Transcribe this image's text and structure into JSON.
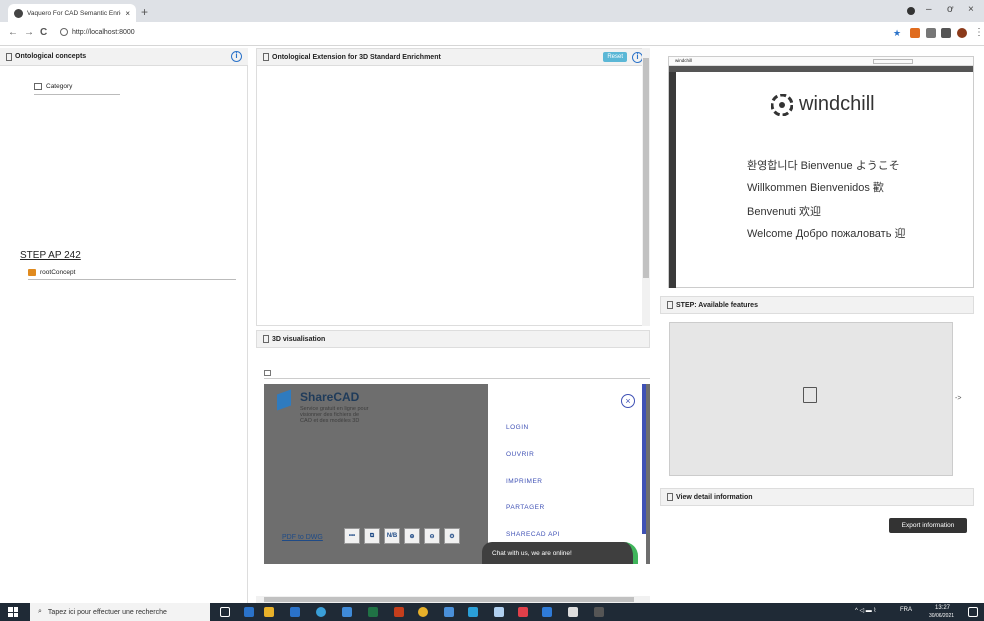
{
  "browser": {
    "tab_title": "Vaquero For CAD Semantic Enric",
    "tab_close": "×",
    "new_tab": "+",
    "url": "http://localhost:8000",
    "nav_back": "←",
    "nav_forward": "→",
    "nav_reload": "C",
    "window_min": "–",
    "window_max": "ơ",
    "window_close": "×",
    "menu": "⋮"
  },
  "left_panel": {
    "title": "Ontological concepts",
    "info": "i",
    "category_item": "Category",
    "step_title": "STEP AP 242",
    "root_item": "rootConcept"
  },
  "mid_panel": {
    "title": "Ontological Extension for 3D Standard Enrichment",
    "reset_label": "Reset",
    "info": "i",
    "vis_title": "3D visualisation"
  },
  "sharecad": {
    "title": "ShareCAD",
    "subtitle": "Service gratuit en ligne pour visionner des fichiers de CAO et des modèles 3D",
    "pdf_link": "PDF to DWG",
    "tools": [
      "•••",
      "⧉",
      "N/B",
      "⊕",
      "⊖",
      "⚙"
    ],
    "close": "×",
    "menu_items": [
      "LOGIN",
      "OUVRIR",
      "IMPRIMER",
      "PARTAGER",
      "SHARECAD API"
    ],
    "chat": "Chat with us, we are online!"
  },
  "windchill": {
    "header_brand": "windchill",
    "logo_text": "windchill",
    "greeting_lines": [
      "환영합니다 Bienvenue ようこそ",
      "Willkommen Bienvenidos 歡",
      "Benvenuti 欢迎",
      "Welcome Добро пожаловать 迎"
    ]
  },
  "right_panel": {
    "step_title": "STEP: Available features",
    "arrow": "->",
    "detail_title": "View detail information",
    "export_label": "Export information"
  },
  "taskbar": {
    "search_placeholder": "Tapez ici pour effectuer une recherche",
    "lang": "FRA",
    "time": "13:27",
    "date": "30/06/2021"
  },
  "colors": {
    "accent": "#2a72c9",
    "sharecad_blue": "#3f51b5",
    "taskbar": "#1f2a36",
    "chat_green": "#3fb55b"
  }
}
